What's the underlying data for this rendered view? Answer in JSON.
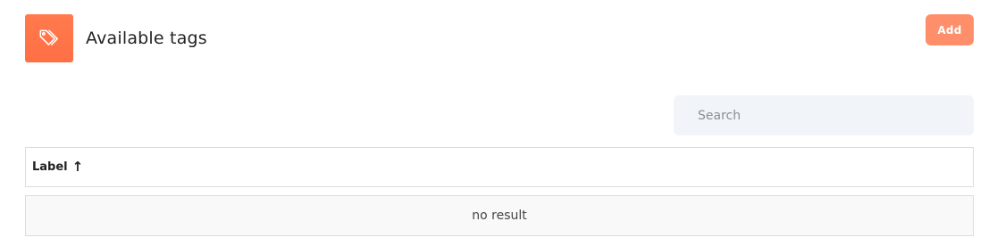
{
  "header": {
    "title": "Available tags",
    "icon": "tags-icon",
    "icon_bg": "#ff7a4d",
    "add_label": "Add"
  },
  "search": {
    "placeholder": "Search",
    "value": ""
  },
  "table": {
    "columns": [
      {
        "label": "Label",
        "sort": "ascending",
        "sort_icon": "↑"
      }
    ],
    "rows": [],
    "empty_text": "no result"
  }
}
